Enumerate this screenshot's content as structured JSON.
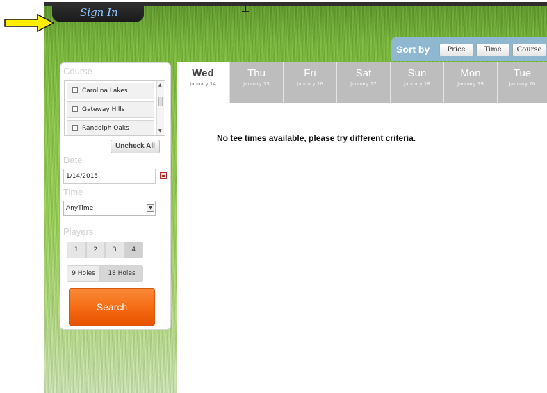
{
  "header": {
    "signin_label": "Sign In"
  },
  "sort": {
    "label": "Sort by",
    "buttons": [
      "Price",
      "Time",
      "Course"
    ]
  },
  "search_panel": {
    "course_label": "Course",
    "courses": [
      "Carolina Lakes",
      "Gateway Hills",
      "Randolph Oaks"
    ],
    "uncheck_all": "Uncheck All",
    "date_label": "Date",
    "date_value": "1/14/2015",
    "time_label": "Time",
    "time_value": "AnyTime",
    "players_label": "Players",
    "players": [
      "1",
      "2",
      "3",
      "4"
    ],
    "selected_players": "4",
    "holes": [
      "9 Holes",
      "18 Holes"
    ],
    "selected_holes": "18 Holes",
    "search_label": "Search"
  },
  "days": [
    {
      "name": "Wed",
      "date": "January 14"
    },
    {
      "name": "Thu",
      "date": "January 15"
    },
    {
      "name": "Fri",
      "date": "January 16"
    },
    {
      "name": "Sat",
      "date": "January 17"
    },
    {
      "name": "Sun",
      "date": "January 18"
    },
    {
      "name": "Mon",
      "date": "January 19"
    },
    {
      "name": "Tue",
      "date": "January 20"
    }
  ],
  "message": "No tee times available, please try different criteria.",
  "colors": {
    "search": "#f46a12",
    "sort_bar": "#8fb8d0",
    "inactive_day": "#bdbdbd",
    "signin_text": "#8ec6ff",
    "arrow": "#ffee00"
  }
}
